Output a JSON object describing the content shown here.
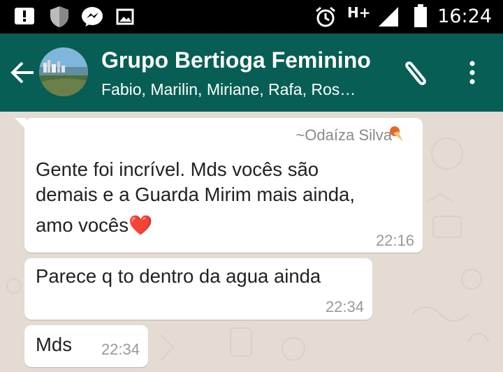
{
  "status_bar": {
    "time": "16:24",
    "network": "H+",
    "icons": [
      "alert-icon",
      "shield-icon",
      "messenger-icon",
      "image-icon",
      "alarm-icon",
      "signal-icon",
      "battery-icon"
    ]
  },
  "header": {
    "title": "Grupo Bertioga Feminino",
    "subtitle": "Fabio, Marilin, Miriane, Rafa, Ros…",
    "colors": {
      "bar": "#075e54",
      "status_bar": "#000000"
    }
  },
  "messages": [
    {
      "sender": "~Odaíza Silva",
      "lines": [
        "Gente foi incrível. Mds vocês são",
        "demais e a Guarda Mirim mais ainda,",
        "amo vocês❤️"
      ],
      "time": "22:16"
    },
    {
      "sender": "",
      "lines": [
        "Parece q to dentro da agua ainda"
      ],
      "time": "22:34"
    },
    {
      "sender": "",
      "lines": [
        "Mds"
      ],
      "time": "22:34"
    }
  ]
}
